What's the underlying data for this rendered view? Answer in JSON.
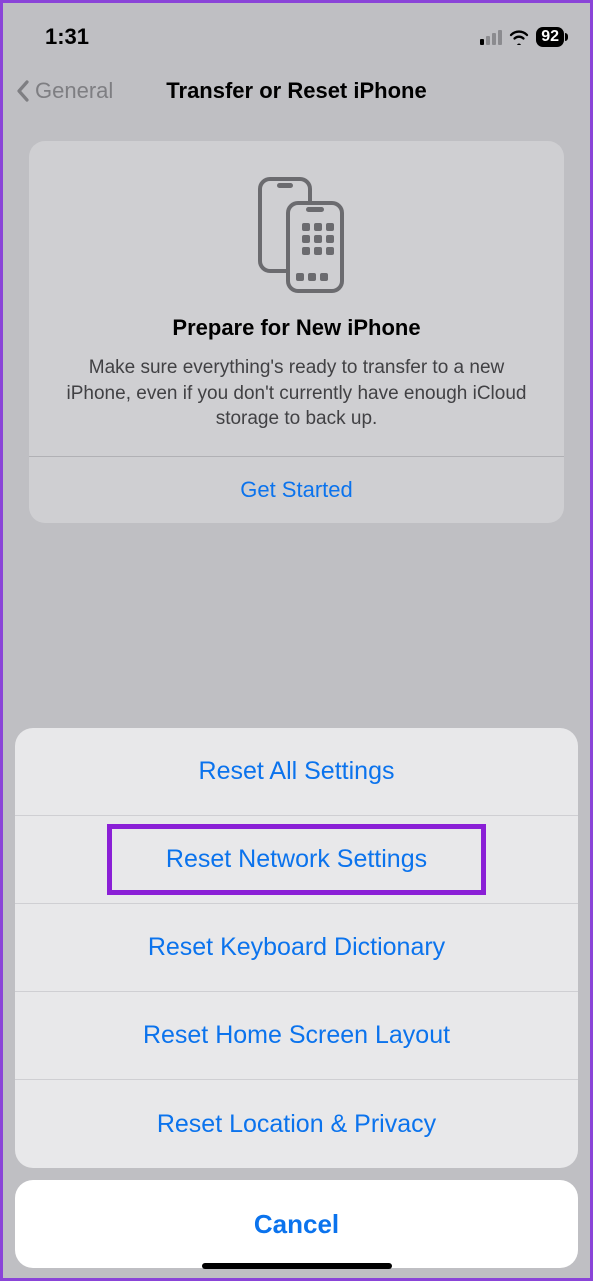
{
  "status": {
    "time": "1:31",
    "battery": "92"
  },
  "nav": {
    "back_label": "General",
    "title": "Transfer or Reset iPhone"
  },
  "card": {
    "title": "Prepare for New iPhone",
    "description": "Make sure everything's ready to transfer to a new iPhone, even if you don't currently have enough iCloud storage to back up.",
    "action": "Get Started"
  },
  "sheet": {
    "items": [
      {
        "label": "Reset All Settings",
        "highlighted": false
      },
      {
        "label": "Reset Network Settings",
        "highlighted": true
      },
      {
        "label": "Reset Keyboard Dictionary",
        "highlighted": false
      },
      {
        "label": "Reset Home Screen Layout",
        "highlighted": false
      },
      {
        "label": "Reset Location & Privacy",
        "highlighted": false
      }
    ],
    "cancel": "Cancel"
  }
}
